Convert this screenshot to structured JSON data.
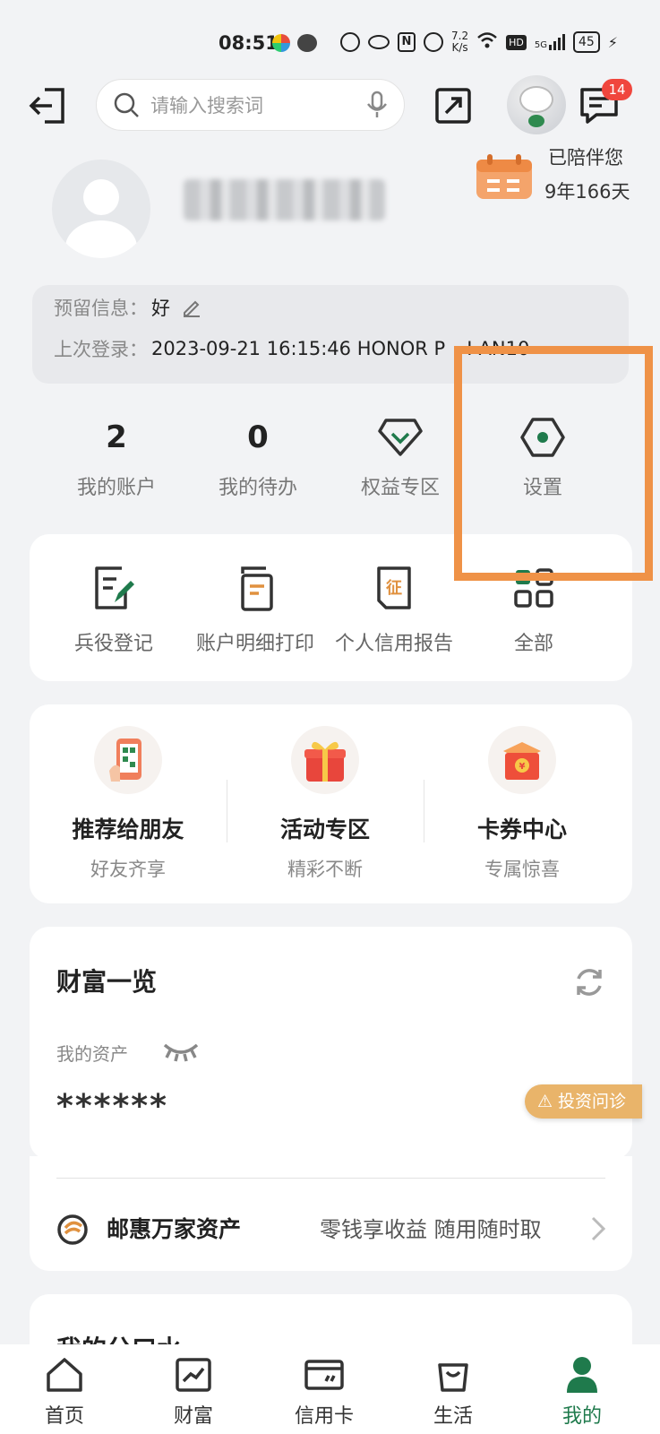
{
  "status_bar": {
    "time": "08:51",
    "net_speed_value": "7.2",
    "net_speed_unit": "K/s",
    "signal": "5G",
    "battery": "45"
  },
  "header": {
    "search_placeholder": "请输入搜索词",
    "message_badge": "14",
    "icons": [
      "exit-icon",
      "search-icon",
      "microphone-icon",
      "share-icon",
      "mascot",
      "message-icon"
    ]
  },
  "companion": {
    "line1": "已陪伴您",
    "line2": "9年166天"
  },
  "profile": {
    "info_label": "预留信息：",
    "info_value": "好",
    "last_login_label": "上次登录：",
    "last_login_value": "2023-09-21 16:15:46 HONOR P",
    "last_login_value_end": "I-AN10"
  },
  "stats": [
    {
      "value": "2",
      "label": "我的账户"
    },
    {
      "value": "0",
      "label": "我的待办"
    },
    {
      "icon": "diamond-icon",
      "label": "权益专区"
    },
    {
      "icon": "settings-icon",
      "label": "设置"
    }
  ],
  "quick_actions": [
    {
      "icon": "register-icon",
      "label": "兵役登记"
    },
    {
      "icon": "print-icon",
      "label": "账户明细打印"
    },
    {
      "icon": "credit-report-icon",
      "label": "个人信用报告"
    },
    {
      "icon": "grid-icon",
      "label": "全部"
    }
  ],
  "promos": [
    {
      "title": "推荐给朋友",
      "subtitle": "好友齐享"
    },
    {
      "title": "活动专区",
      "subtitle": "精彩不断"
    },
    {
      "title": "卡券中心",
      "subtitle": "专属惊喜"
    }
  ],
  "wealth": {
    "title": "财富一览",
    "assets_label": "我的资产",
    "assets_value": "******",
    "invest_button": "投资问诊"
  },
  "youhui": {
    "title": "邮惠万家资产",
    "desc": "零钱享收益 随用随时取"
  },
  "peek": {
    "title": "我的分口水"
  },
  "bottom_nav": [
    {
      "label": "首页"
    },
    {
      "label": "财富"
    },
    {
      "label": "信用卡"
    },
    {
      "label": "生活"
    },
    {
      "label": "我的"
    }
  ],
  "colors": {
    "accent_green": "#1f7a4c",
    "highlight_orange": "#ef9247",
    "badge_red": "#f0463d",
    "invest_gold": "#e9b46a"
  }
}
